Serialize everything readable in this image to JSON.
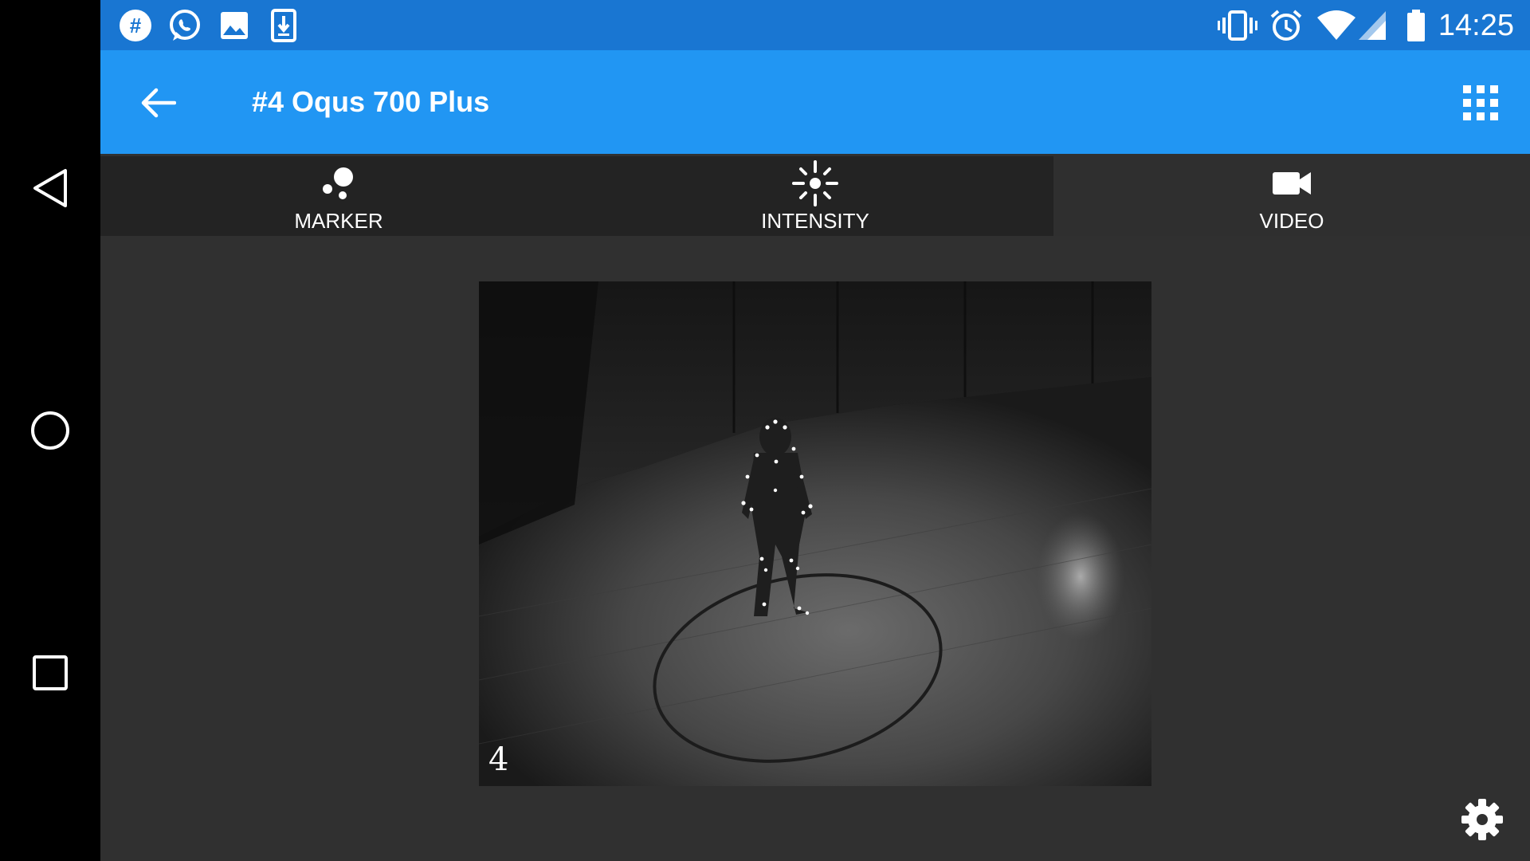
{
  "status_bar": {
    "time": "14:25",
    "icons": [
      "slack-icon",
      "whatsapp-icon",
      "gallery-icon",
      "download-icon",
      "vibrate-icon",
      "alarm-icon",
      "wifi-icon",
      "signal-icon",
      "battery-icon"
    ]
  },
  "app_bar": {
    "title": "#4 Oqus 700 Plus",
    "back_icon": "arrow-back-icon",
    "menu_icon": "apps-grid-icon"
  },
  "tabs": [
    {
      "label": "MARKER",
      "icon": "marker-icon",
      "active": false
    },
    {
      "label": "INTENSITY",
      "icon": "intensity-icon",
      "active": false
    },
    {
      "label": "VIDEO",
      "icon": "videocam-icon",
      "active": true
    }
  ],
  "video": {
    "camera_number": "4"
  },
  "colors": {
    "status_bar": "#1976D2",
    "app_bar": "#2196F3",
    "background": "#303030",
    "tab_bar": "#232323"
  }
}
